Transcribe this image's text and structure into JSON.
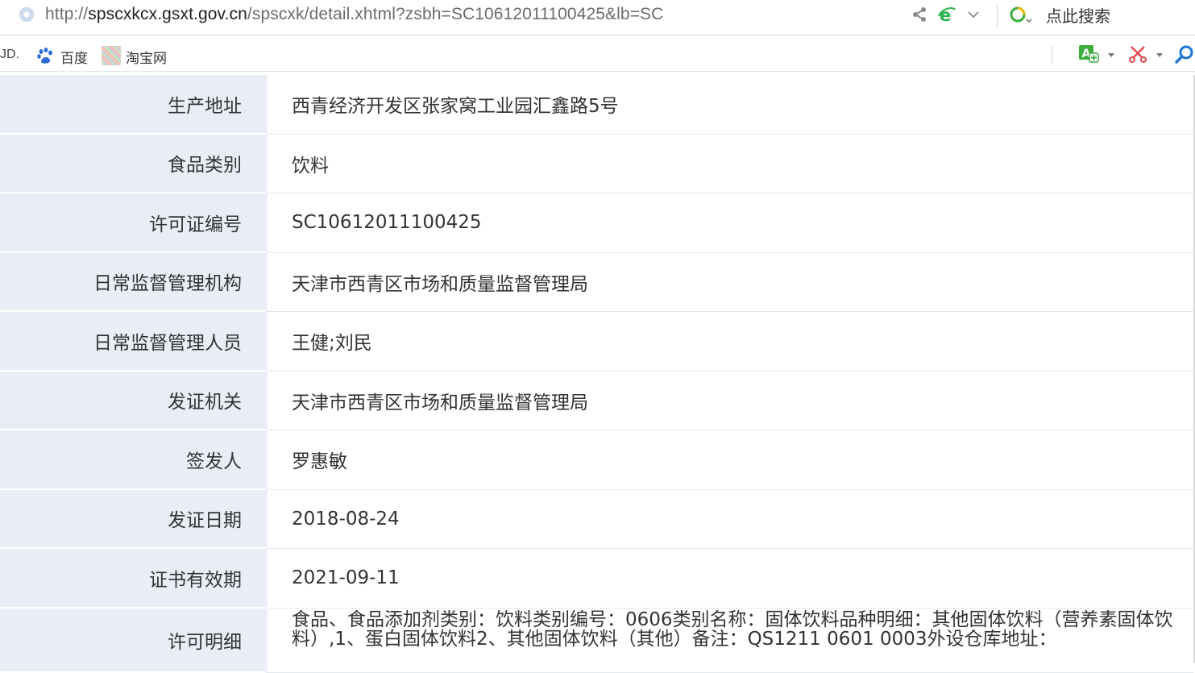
{
  "browser": {
    "url_prefix": "http://",
    "url_host": "spscxkcx.gsxt.gov.cn",
    "url_path": "/spscxk/detail.xhtml?zsbh=SC10612011100425&lb=SC",
    "search_placeholder": "点此搜索"
  },
  "bookmarks": [
    {
      "label": "JD.",
      "icon": "jd-icon"
    },
    {
      "label": "百度",
      "icon": "baidu-paw-icon"
    },
    {
      "label": "淘宝网",
      "icon": "taobao-icon"
    }
  ],
  "colors": {
    "label_bg": "#e9eef6",
    "value_bg": "#ffffff",
    "accent_green": "#3cae3c",
    "accent_red": "#e5484d",
    "accent_blue": "#1f78d1"
  },
  "details": [
    {
      "label": "生产地址",
      "value": "西青经济开发区张家窝工业园汇鑫路5号"
    },
    {
      "label": "食品类别",
      "value": "饮料"
    },
    {
      "label": "许可证编号",
      "value": "SC10612011100425"
    },
    {
      "label": "日常监督管理机构",
      "value": "天津市西青区市场和质量监督管理局"
    },
    {
      "label": "日常监督管理人员",
      "value": "王健;刘民"
    },
    {
      "label": "发证机关",
      "value": "天津市西青区市场和质量监督管理局"
    },
    {
      "label": "签发人",
      "value": "罗惠敏"
    },
    {
      "label": "发证日期",
      "value": "2018-08-24"
    },
    {
      "label": "证书有效期",
      "value": "2021-09-11"
    },
    {
      "label": "许可明细",
      "value": "食品、食品添加剂类别：饮料类别编号：0606类别名称：固体饮料品种明细：其他固体饮料（营养素固体饮料）,1、蛋白固体饮料2、其他固体饮料（其他）备注：QS1211 0601 0003外设仓库地址："
    }
  ]
}
